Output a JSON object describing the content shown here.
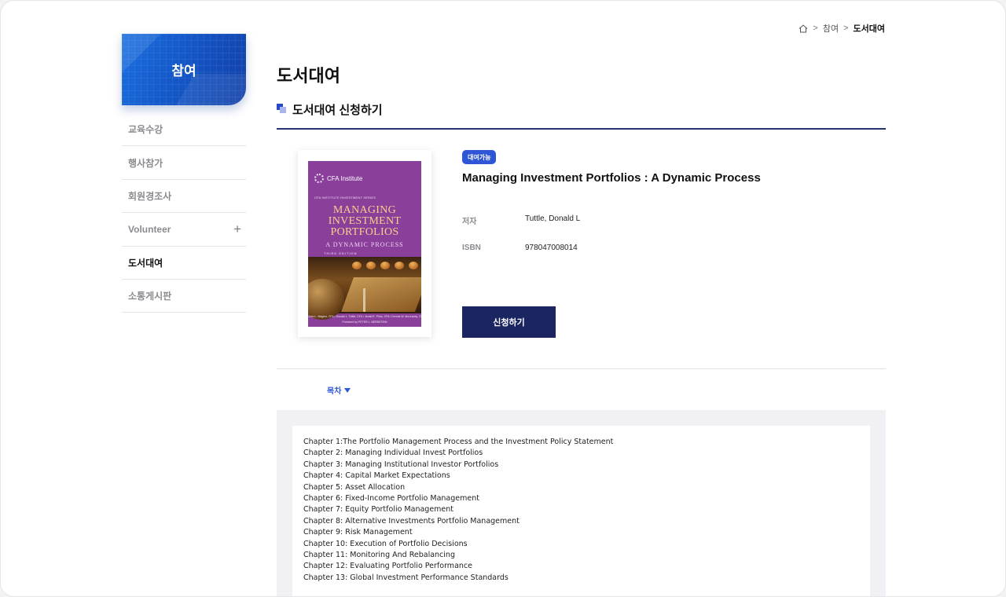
{
  "breadcrumb": {
    "home_icon": "home-icon",
    "items": [
      "참여",
      "도서대여"
    ],
    "separator": ">"
  },
  "sidebar": {
    "title": "참여",
    "items": [
      {
        "label": "교육수강"
      },
      {
        "label": "행사참가"
      },
      {
        "label": "회원경조사"
      },
      {
        "label": "Volunteer",
        "expand_symbol": "+"
      },
      {
        "label": "도서대여"
      },
      {
        "label": "소통게시판"
      }
    ]
  },
  "page": {
    "title": "도서대여",
    "section_title": "도서대여 신청하기"
  },
  "book": {
    "status_badge": "대여가능",
    "title": "Managing Investment Portfolios : A Dynamic Process",
    "author_label": "저자",
    "author": "Tuttle, Donald L",
    "isbn_label": "ISBN",
    "isbn": "978047008014",
    "apply_button": "신청하기",
    "cover": {
      "publisher": "CFA Institute",
      "series": "CFA INSTITUTE INVESTMENT SERIES",
      "title_lines": [
        "MANAGING",
        "INVESTMENT",
        "PORTFOLIOS"
      ],
      "subtitle": "A DYNAMIC PROCESS",
      "edition": "THIRD EDITION",
      "authors": "John L. Maginn, CFA • Donald L. Tuttle, CFA • Jerald E. Pinto, CFA • Dennis W. McLeavey, CFA",
      "foreword": "Foreword by PETER L. BERNSTEIN"
    }
  },
  "toc": {
    "toggle_label": "목차",
    "chapters": [
      "Chapter 1:The Portfolio Management Process and the Investment Policy Statement",
      "Chapter 2: Managing Individual Invest Portfolios",
      "Chapter 3: Managing Institutional Investor Portfolios",
      "Chapter 4: Capital Market Expectations",
      "Chapter 5: Asset Allocation",
      "Chapter 6: Fixed-Income Portfolio Management",
      "Chapter 7: Equity Portfolio Management",
      "Chapter 8: Alternative Investments Portfolio Management",
      "Chapter 9: Risk Management",
      "Chapter 10: Execution of Portfolio Decisions",
      "Chapter 11: Monitoring And Rebalancing",
      "Chapter 12: Evaluating Portfolio Performance",
      "Chapter 13: Global Investment Performance Standards"
    ]
  },
  "colors": {
    "accent": "#2f56d6",
    "navy": "#1b2561",
    "book_cover": "#8a3f9b"
  }
}
